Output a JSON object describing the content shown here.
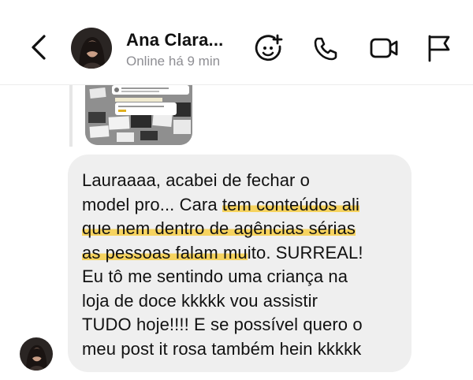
{
  "header": {
    "contact_name": "Ana Clara...",
    "status": "Online há 9 min",
    "icons": [
      "back-arrow-icon",
      "add-effects-icon",
      "phone-icon",
      "video-icon",
      "flag-icon"
    ]
  },
  "message": {
    "lines": [
      {
        "plain": "Lauraaaa, acabei de fechar o",
        "hl": "",
        "after": ""
      },
      {
        "plain": "model pro... Cara ",
        "hl": "tem conteúdos ali",
        "after": ""
      },
      {
        "plain": "",
        "hl": "que nem dentro de agências sérias",
        "after": ""
      },
      {
        "plain": "",
        "hl": "as pessoas falam mu",
        "after": "ito. SURREAL!"
      },
      {
        "plain": "Eu tô me sentindo uma criança na",
        "hl": "",
        "after": ""
      },
      {
        "plain": "loja de doce kkkkk vou assistir",
        "hl": "",
        "after": ""
      },
      {
        "plain": "TUDO hoje!!!! E se possível quero o",
        "hl": "",
        "after": ""
      },
      {
        "plain": "meu post it rosa também hein kkkkk",
        "hl": "",
        "after": ""
      }
    ]
  },
  "colors": {
    "bubble": "#efefef",
    "highlight": "#f7ce46",
    "status": "#8e8e93"
  }
}
